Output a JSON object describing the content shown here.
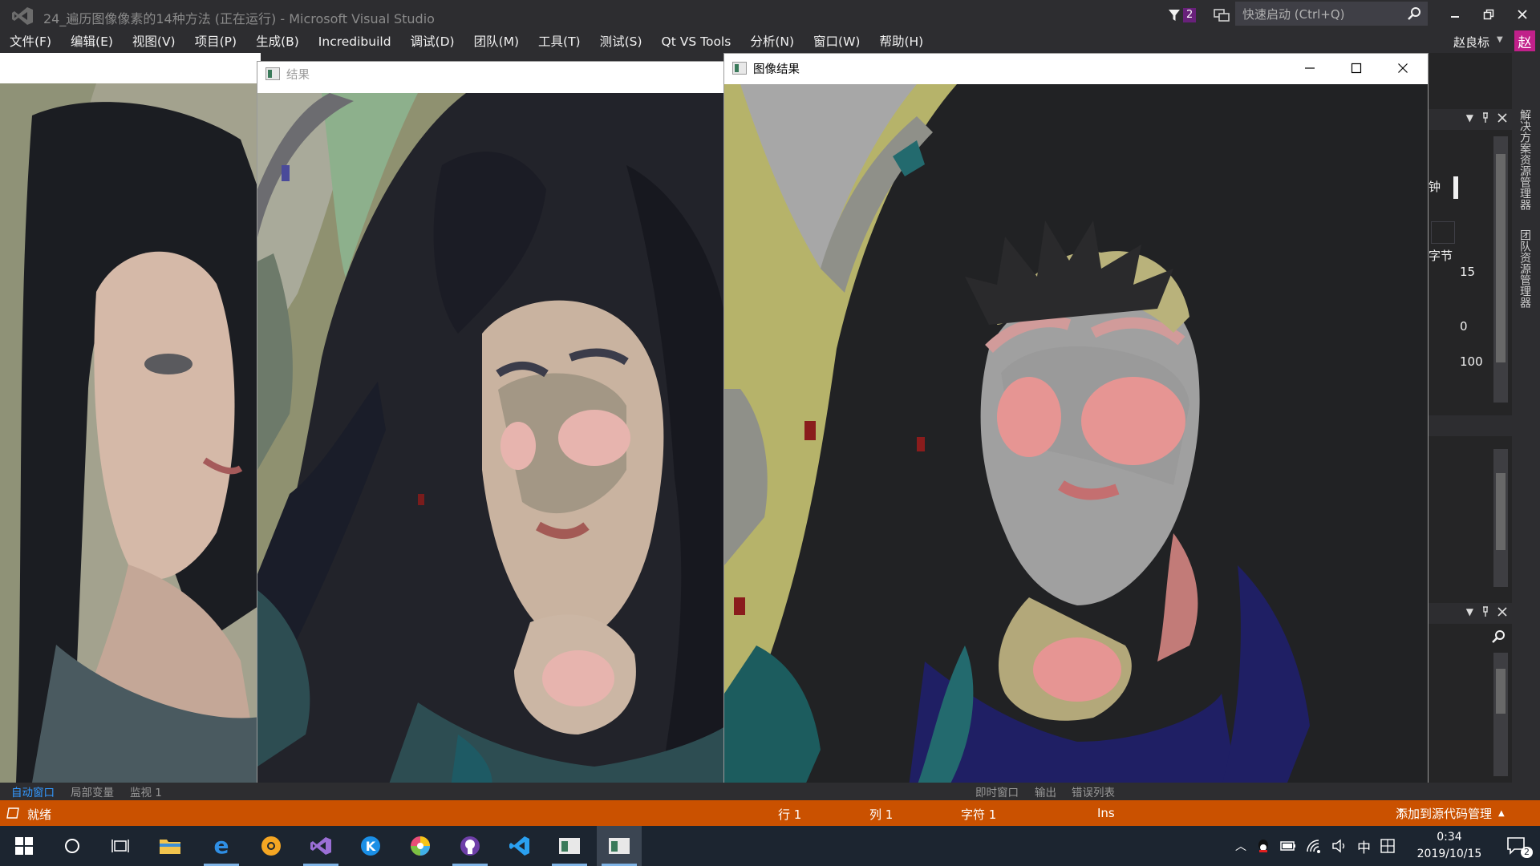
{
  "titlebar": {
    "title": "24_遍历图像像素的14种方法 (正在运行) - Microsoft Visual Studio",
    "notification_count": "2",
    "quick_launch_placeholder": "快速启动 (Ctrl+Q)"
  },
  "menu": [
    "文件(F)",
    "编辑(E)",
    "视图(V)",
    "项目(P)",
    "生成(B)",
    "Incredibuild",
    "调试(D)",
    "团队(M)",
    "工具(T)",
    "测试(S)",
    "Qt VS Tools",
    "分析(N)",
    "窗口(W)",
    "帮助(H)"
  ],
  "user": {
    "name": "赵良标",
    "avatar_initial": "赵"
  },
  "window_result": {
    "title": "结果"
  },
  "window_image_result": {
    "title": "图像结果"
  },
  "right_panel": {
    "vertical_tabs": [
      "解决方案资源管理器",
      "团队资源管理器"
    ],
    "text_clock": "钟",
    "text_bytes": "字节",
    "values": [
      "15",
      "0",
      "100"
    ]
  },
  "bottom_tabs": {
    "left": [
      "自动窗口",
      "局部变量",
      "监视 1"
    ],
    "right": [
      "即时窗口",
      "输出",
      "错误列表"
    ]
  },
  "statusbar": {
    "ready": "就绪",
    "line": "行 1",
    "col": "列 1",
    "char": "字符 1",
    "mode": "Ins",
    "source_control": "添加到源代码管理"
  },
  "taskbar": {
    "apps": [
      "start-icon",
      "cortana-icon",
      "task-view-icon",
      "file-explorer-icon",
      "edge-icon",
      "chrome-canary-icon",
      "visual-studio-icon",
      "kugou-icon",
      "color-app-icon",
      "github-desktop-icon",
      "vscode-icon",
      "image-window-icon",
      "image-result-window-icon"
    ],
    "ime": "中",
    "time": "0:34",
    "date": "2019/10/15",
    "notification_count": "2"
  },
  "colors": {
    "status_bar": "#ca5100",
    "title_bar": "#2d2d30",
    "accent": "#68217a"
  }
}
